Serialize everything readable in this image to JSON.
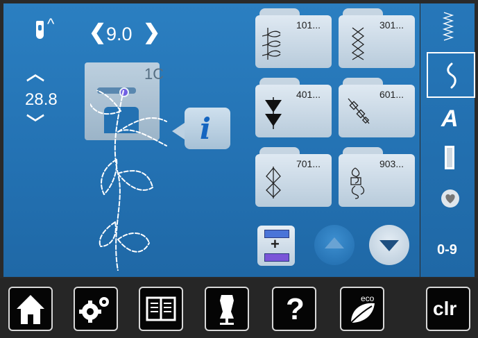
{
  "needle": {
    "caret": "^"
  },
  "stitch_width": {
    "value": "9.0",
    "left_arrow": "❮",
    "right_arrow": "❯"
  },
  "stitch_length": {
    "value": "28.8",
    "up_arrow": "︿",
    "down_arrow": "﹀"
  },
  "presser_foot": {
    "label": "1C"
  },
  "info_button": {
    "label": "i"
  },
  "categories": [
    {
      "number": "101..."
    },
    {
      "number": "301..."
    },
    {
      "number": "401..."
    },
    {
      "number": "601..."
    },
    {
      "number": "701..."
    },
    {
      "number": "903..."
    }
  ],
  "right_menu": {
    "alphabet_label": "A",
    "numbers_label": "0-9"
  },
  "bottom_bar": {
    "help_label": "?",
    "eco_label": "eco",
    "clear_label": "clr"
  }
}
